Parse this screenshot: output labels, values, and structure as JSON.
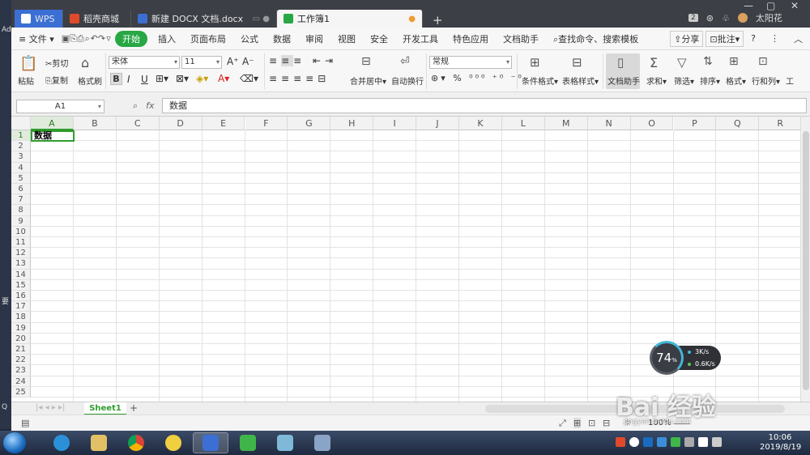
{
  "desktop": {
    "left_labels": [
      "Ad",
      "要",
      "Q"
    ]
  },
  "titlebar": {
    "tabs": [
      {
        "label": "WPS",
        "color": "#3b6fd4"
      },
      {
        "label": "稻壳商城",
        "color": "#e04a2b"
      },
      {
        "label": "新建 DOCX 文档.docx",
        "color": "#3b6fd4"
      },
      {
        "label": "工作簿1",
        "color": "#28a745"
      }
    ],
    "add_tab": "+",
    "badge": "2",
    "user": "太阳花"
  },
  "menubar": {
    "file": "文件",
    "items": [
      "开始",
      "插入",
      "页面布局",
      "公式",
      "数据",
      "审阅",
      "视图",
      "安全",
      "开发工具",
      "特色应用",
      "文档助手"
    ],
    "search": "查找命令、搜索模板",
    "share": "分享",
    "comment": "批注",
    "help": "?"
  },
  "ribbon": {
    "paste": "粘贴",
    "cut": "剪切",
    "copy": "复制",
    "format_painter": "格式刷",
    "font_name": "宋体",
    "font_size": "11",
    "bold": "B",
    "italic": "I",
    "underline": "U",
    "merge_center": "合并居中",
    "wrap": "自动换行",
    "number_format": "常规",
    "conditional": "条件格式",
    "table_style": "表格样式",
    "doc_assist": "文档助手",
    "sum": "求和",
    "filter": "筛选",
    "sort": "排序",
    "format": "格式",
    "rowcol": "行和列",
    "work": "工"
  },
  "formula": {
    "namebox": "A1",
    "fx": "fx",
    "content": "数据"
  },
  "grid": {
    "columns": [
      "A",
      "B",
      "C",
      "D",
      "E",
      "F",
      "G",
      "H",
      "I",
      "J",
      "K",
      "L",
      "M",
      "N",
      "O",
      "P",
      "Q",
      "R"
    ],
    "rows": [
      "1",
      "2",
      "3",
      "4",
      "5",
      "6",
      "7",
      "8",
      "9",
      "10",
      "11",
      "12",
      "13",
      "14",
      "15",
      "16",
      "17",
      "18",
      "19",
      "20",
      "21",
      "22",
      "23",
      "24",
      "25"
    ],
    "a1_value": "数据"
  },
  "sheets": {
    "tabs": [
      "Sheet1"
    ],
    "add": "+"
  },
  "status": {
    "zoom": "100%"
  },
  "speed_widget": {
    "percent": "74",
    "pct_sign": "%",
    "up": "3K/s",
    "down": "0.6K/s"
  },
  "taskbar": {
    "time": "10:06",
    "date": "2019/8/19"
  },
  "watermark": {
    "text": "Bai 经验",
    "sub": "jingyan.baidu.com"
  }
}
